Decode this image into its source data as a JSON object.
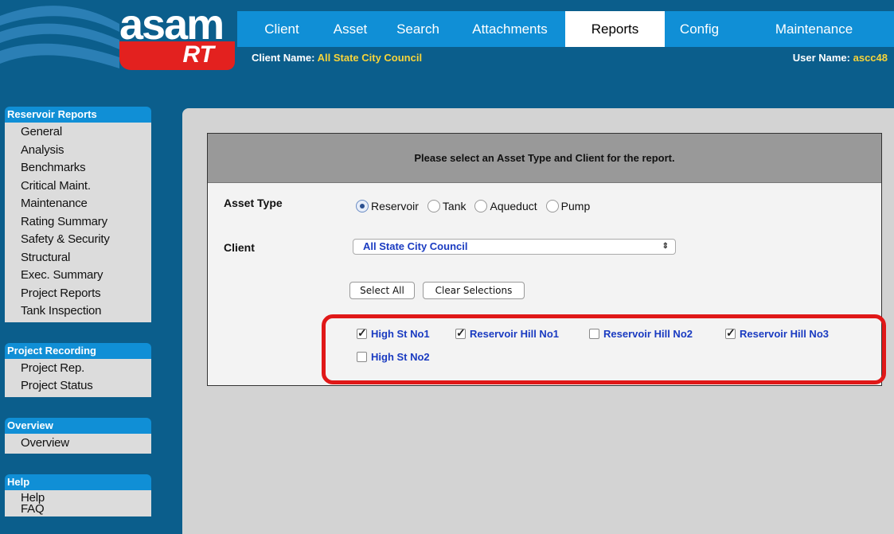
{
  "logo": {
    "word": "asam",
    "sub": "RT"
  },
  "nav": {
    "tabs": [
      "Client",
      "Asset",
      "Search",
      "Attachments",
      "Reports",
      "Config",
      "Maintenance"
    ],
    "active": "Reports"
  },
  "header": {
    "client_label": "Client Name:",
    "client_value": "All State City Council",
    "user_label": "User Name:",
    "user_value": "ascc48"
  },
  "sidebar": {
    "groups": [
      {
        "title": "Reservoir Reports",
        "items": [
          "General",
          "Analysis",
          "Benchmarks",
          "Critical Maint.",
          "Maintenance",
          "Rating Summary",
          "Safety & Security",
          "Structural",
          "Exec. Summary",
          "Project Reports",
          "Tank Inspection"
        ]
      },
      {
        "title": "Project Recording",
        "items": [
          "Project Rep.",
          "Project Status"
        ]
      },
      {
        "title": "Overview",
        "items": [
          "Overview"
        ]
      },
      {
        "title": "Help",
        "items": [
          "Help",
          "FAQ"
        ]
      }
    ]
  },
  "form": {
    "heading": "Please select an Asset Type and Client for the report.",
    "asset_type_label": "Asset Type",
    "asset_types": [
      "Reservoir",
      "Tank",
      "Aqueduct",
      "Pump"
    ],
    "asset_type_selected": "Reservoir",
    "client_label": "Client",
    "client_selected": "All State City Council",
    "select_all": "Select All",
    "clear_selections": "Clear Selections",
    "assets": [
      {
        "name": "High St No1",
        "checked": true
      },
      {
        "name": "Reservoir Hill No1",
        "checked": true
      },
      {
        "name": "Reservoir Hill No2",
        "checked": false
      },
      {
        "name": "Reservoir Hill No3",
        "checked": true
      },
      {
        "name": "High St No2",
        "checked": false
      }
    ]
  },
  "colors": {
    "background": "#0b5e8c",
    "nav_tab": "#108fd6",
    "highlight": "#e01818",
    "link_blue": "#1a3bc1",
    "name_yellow": "#f7d43a"
  }
}
